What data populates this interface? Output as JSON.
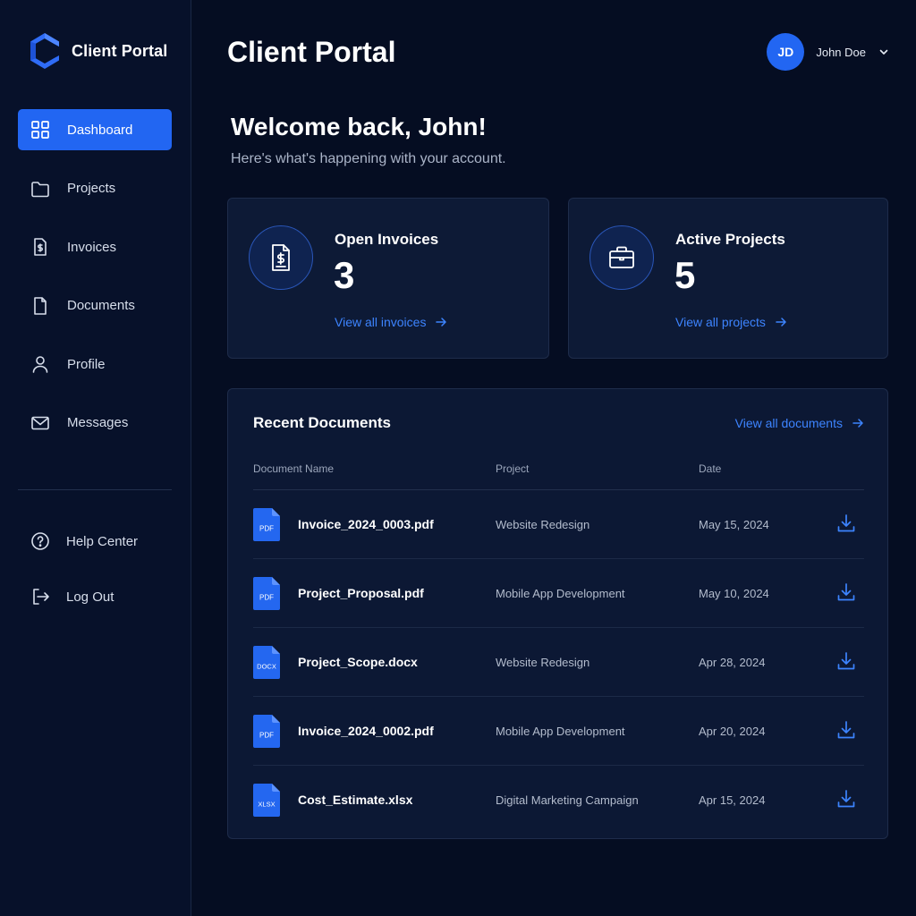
{
  "brand": {
    "name": "Client Portal"
  },
  "sidebar": {
    "items": [
      {
        "label": "Dashboard",
        "icon": "grid-icon",
        "active": true
      },
      {
        "label": "Projects",
        "icon": "folder-icon"
      },
      {
        "label": "Invoices",
        "icon": "invoice-icon"
      },
      {
        "label": "Documents",
        "icon": "document-icon"
      },
      {
        "label": "Profile",
        "icon": "user-icon"
      },
      {
        "label": "Messages",
        "icon": "mail-icon"
      }
    ],
    "secondary": [
      {
        "label": "Help Center",
        "icon": "help-icon"
      },
      {
        "label": "Log Out",
        "icon": "logout-icon"
      }
    ]
  },
  "header": {
    "title": "Client Portal",
    "user": {
      "initials": "JD",
      "name": "John Doe"
    }
  },
  "welcome": {
    "title": "Welcome back, John!",
    "subtitle": "Here's what's happening with your account."
  },
  "cards": {
    "invoices": {
      "title": "Open Invoices",
      "count": "3",
      "link": "View all invoices"
    },
    "projects": {
      "title": "Active Projects",
      "count": "5",
      "link": "View all projects"
    }
  },
  "documents": {
    "title": "Recent Documents",
    "view_all": "View all documents",
    "columns": {
      "name": "Document Name",
      "project": "Project",
      "date": "Date"
    },
    "rows": [
      {
        "type": "PDF",
        "name": "Invoice_2024_0003.pdf",
        "project": "Website Redesign",
        "date": "May 15, 2024"
      },
      {
        "type": "PDF",
        "name": "Project_Proposal.pdf",
        "project": "Mobile App Development",
        "date": "May 10, 2024"
      },
      {
        "type": "DOCX",
        "name": "Project_Scope.docx",
        "project": "Website Redesign",
        "date": "Apr 28, 2024"
      },
      {
        "type": "PDF",
        "name": "Invoice_2024_0002.pdf",
        "project": "Mobile App Development",
        "date": "Apr 20, 2024"
      },
      {
        "type": "XLSX",
        "name": "Cost_Estimate.xlsx",
        "project": "Digital Marketing Campaign",
        "date": "Apr 15, 2024"
      }
    ]
  },
  "colors": {
    "accent": "#2266f2",
    "link": "#3d84ff",
    "background": "#050d22",
    "sidebar": "#07112a",
    "card": "#0d1a36"
  }
}
